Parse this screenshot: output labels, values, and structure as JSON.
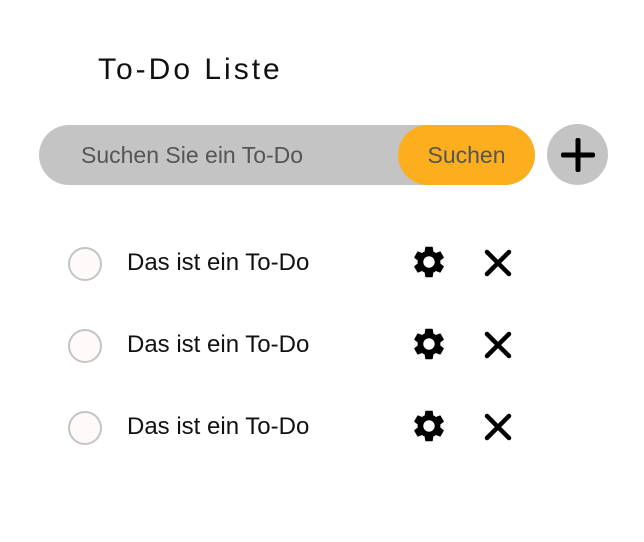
{
  "header": {
    "title": "To-Do Liste"
  },
  "search": {
    "placeholder": "Suchen Sie ein To-Do",
    "value": "",
    "button_label": "Suchen"
  },
  "add_button": {
    "icon": "plus-icon"
  },
  "todos": [
    {
      "text": "Das ist ein To-Do",
      "done": false
    },
    {
      "text": "Das ist ein To-Do",
      "done": false
    },
    {
      "text": "Das ist ein To-Do",
      "done": false
    }
  ],
  "icons": {
    "settings": "gear-icon",
    "delete": "close-icon"
  },
  "colors": {
    "search_bar_bg": "#c4c4c4",
    "search_button_bg": "#fcae1e",
    "checkbox_border": "#c4c4c4",
    "text": "#111111",
    "muted_text": "#555555"
  }
}
